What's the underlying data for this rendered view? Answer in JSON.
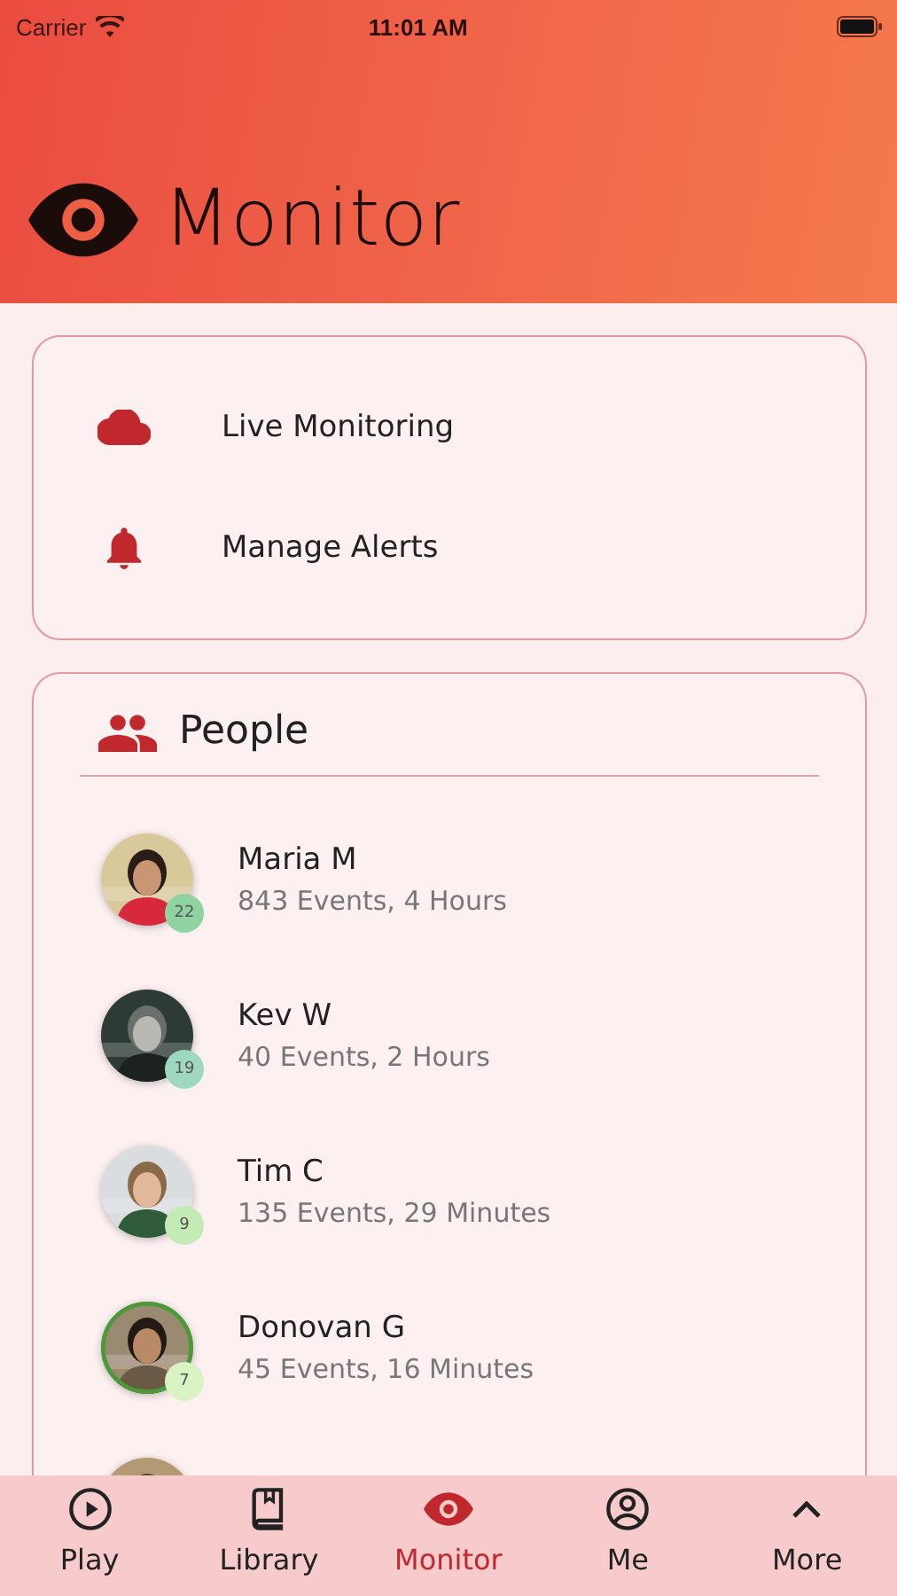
{
  "status_bar": {
    "carrier": "Carrier",
    "time": "11:01 AM"
  },
  "header": {
    "title": "Monitor"
  },
  "menu": [
    {
      "kind": "cloud",
      "label": "Live Monitoring"
    },
    {
      "kind": "bell",
      "label": "Manage Alerts"
    }
  ],
  "people": {
    "title": "People",
    "items": [
      {
        "kind": "person",
        "name": "Maria M",
        "summary": "843 Events, 4 Hours",
        "badge": "22",
        "color": "#8fd3a0",
        "ringed": false
      },
      {
        "kind": "person",
        "name": "Kev W",
        "summary": "40 Events, 2 Hours",
        "badge": "19",
        "color": "#9ed9bf",
        "ringed": false
      },
      {
        "kind": "person",
        "name": "Tim C",
        "summary": "135 Events, 29 Minutes",
        "badge": "9",
        "color": "#c4ebb4",
        "ringed": false
      },
      {
        "kind": "person",
        "name": "Donovan G",
        "summary": "45 Events, 16 Minutes",
        "badge": "7",
        "color": "#d9f3c2",
        "ringed": true
      },
      {
        "kind": "partial"
      }
    ]
  },
  "tabs": [
    {
      "kind": "play",
      "label": "Play",
      "selected": false
    },
    {
      "kind": "book",
      "label": "Library",
      "selected": false
    },
    {
      "kind": "eye",
      "label": "Monitor",
      "selected": true
    },
    {
      "kind": "user",
      "label": "Me",
      "selected": false
    },
    {
      "kind": "chevron",
      "label": "More",
      "selected": false
    }
  ]
}
